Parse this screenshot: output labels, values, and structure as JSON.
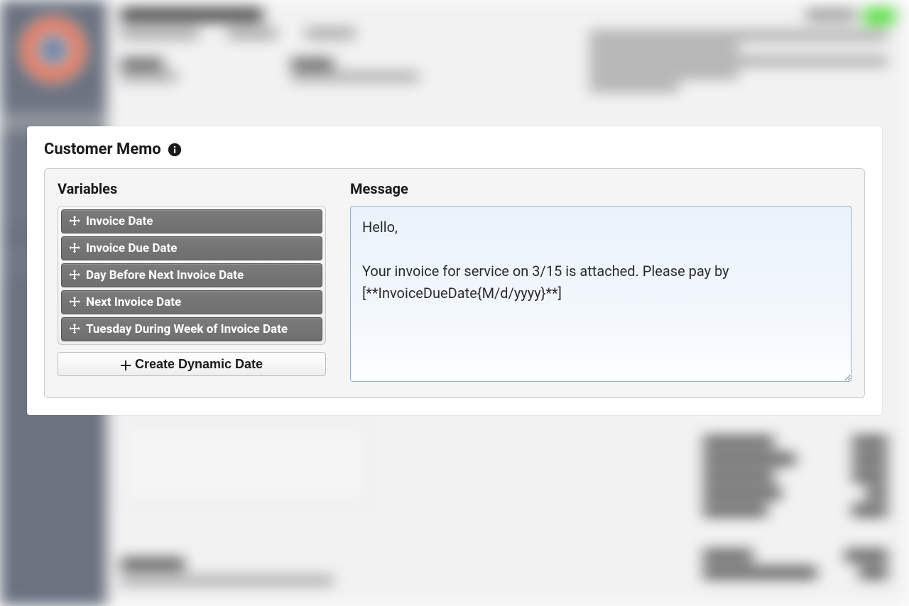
{
  "modal": {
    "title": "Customer Memo",
    "variables_heading": "Variables",
    "message_heading": "Message",
    "variables": [
      {
        "label": "Invoice Date"
      },
      {
        "label": "Invoice Due Date"
      },
      {
        "label": "Day Before Next Invoice Date"
      },
      {
        "label": "Next Invoice Date"
      },
      {
        "label": "Tuesday During Week of Invoice Date"
      }
    ],
    "create_button_label": "Create Dynamic Date",
    "message_text": "Hello,\n\nYour invoice for service on 3/15 is attached. Please pay by [**InvoiceDueDate{M/d/yyyy}**]"
  }
}
